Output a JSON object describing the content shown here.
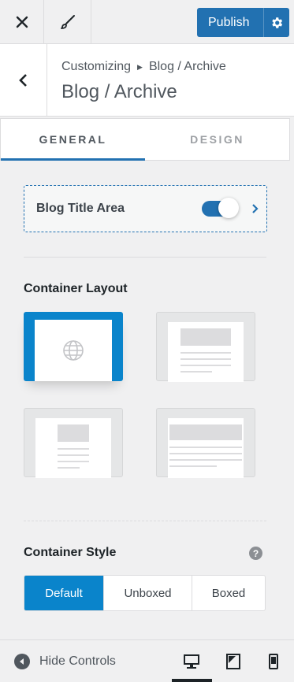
{
  "topbar": {
    "close_icon": "close-icon",
    "brush_icon": "paintbrush-icon",
    "publish_label": "Publish",
    "settings_icon": "gear-icon"
  },
  "section": {
    "back_icon": "chevron-left-icon",
    "breadcrumb_root": "Customizing",
    "breadcrumb_current": "Blog / Archive",
    "title": "Blog / Archive"
  },
  "tabs": [
    {
      "label": "GENERAL",
      "active": true
    },
    {
      "label": "DESIGN",
      "active": false
    }
  ],
  "blog_title_area": {
    "label": "Blog Title Area",
    "enabled": true
  },
  "container_layout": {
    "title": "Container Layout",
    "options": [
      {
        "name": "full-width",
        "selected": true
      },
      {
        "name": "boxed-content",
        "selected": false
      },
      {
        "name": "narrow-content",
        "selected": false
      },
      {
        "name": "wide-content",
        "selected": false
      }
    ]
  },
  "container_style": {
    "title": "Container Style",
    "help_icon": "?",
    "options": [
      "Default",
      "Unboxed",
      "Boxed"
    ],
    "selected": "Default"
  },
  "footer": {
    "hide_controls_label": "Hide Controls",
    "devices": [
      "desktop-icon",
      "tablet-icon",
      "mobile-icon"
    ],
    "active_device": "desktop"
  },
  "colors": {
    "accent": "#2271b1",
    "selected": "#0a84cb",
    "background": "#f0f0f1"
  }
}
